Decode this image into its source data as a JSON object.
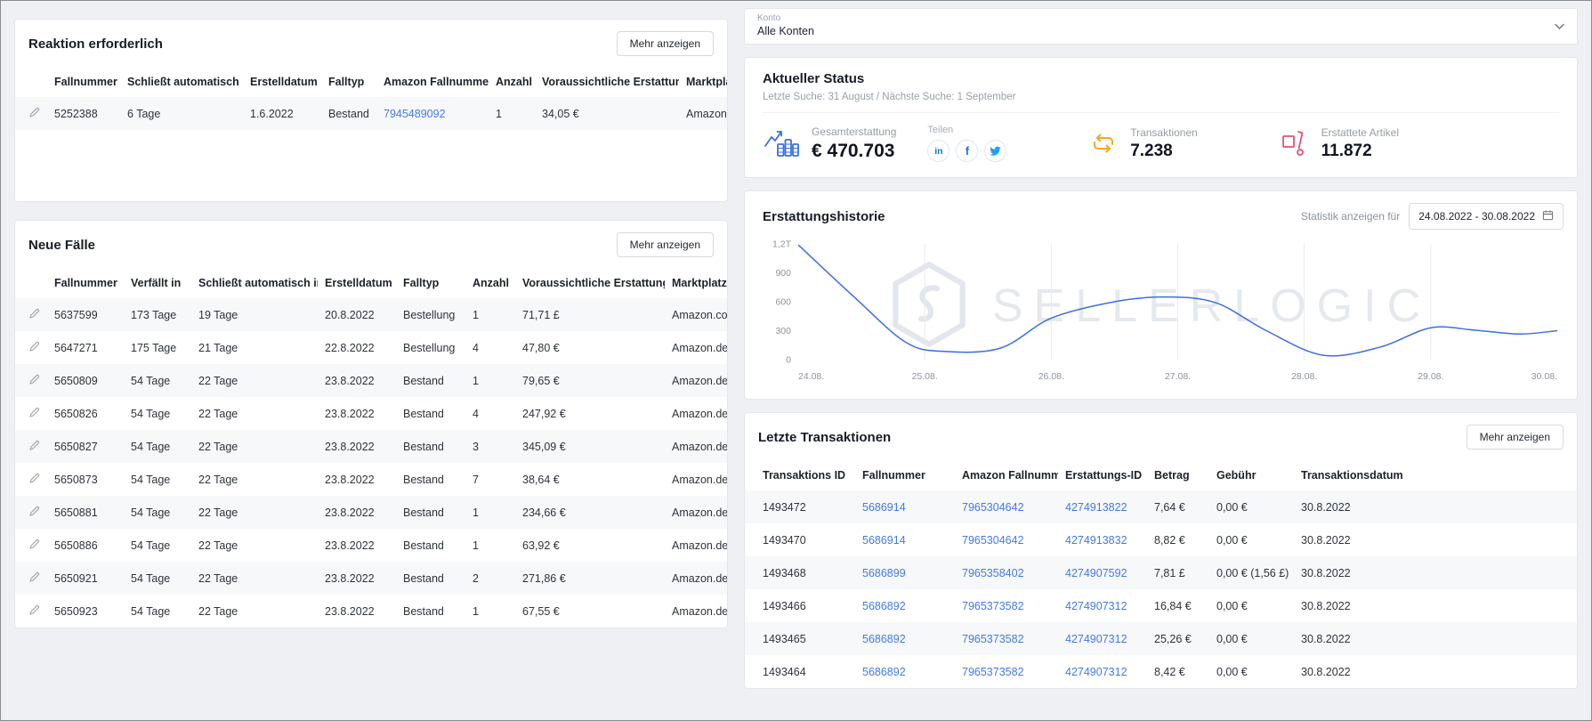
{
  "colors": {
    "accent": "#3d6ee0",
    "link": "#4479e4",
    "orange": "#f5a623",
    "pink": "#e8506e"
  },
  "account_bar": {
    "label": "Konto",
    "value": "Alle Konten"
  },
  "reaction_panel": {
    "title": "Reaktion erforderlich",
    "more_label": "Mehr anzeigen",
    "columns": [
      "Fallnummer",
      "Schließt automatisch in",
      "Erstelldatum",
      "Falltyp",
      "Amazon Fallnummer",
      "Anzahl",
      "Voraussichtliche Erstattung",
      "Marktplatz"
    ],
    "rows": [
      [
        "5252388",
        "6 Tage",
        "1.6.2022",
        "Bestand",
        "7945489092",
        "1",
        "34,05 €",
        "Amazon.de"
      ]
    ]
  },
  "new_cases_panel": {
    "title": "Neue Fälle",
    "more_label": "Mehr anzeigen",
    "columns": [
      "Fallnummer",
      "Verfällt in",
      "Schließt automatisch in",
      "Erstelldatum",
      "Falltyp",
      "Anzahl",
      "Voraussichtliche Erstattung",
      "Marktplatz"
    ],
    "rows": [
      [
        "5637599",
        "173 Tage",
        "19 Tage",
        "20.8.2022",
        "Bestellung",
        "1",
        "71,71 £",
        "Amazon.co.uk"
      ],
      [
        "5647271",
        "175 Tage",
        "21 Tage",
        "22.8.2022",
        "Bestellung",
        "4",
        "47,80 €",
        "Amazon.de"
      ],
      [
        "5650809",
        "54 Tage",
        "22 Tage",
        "23.8.2022",
        "Bestand",
        "1",
        "79,65 €",
        "Amazon.de"
      ],
      [
        "5650826",
        "54 Tage",
        "22 Tage",
        "23.8.2022",
        "Bestand",
        "4",
        "247,92 €",
        "Amazon.de"
      ],
      [
        "5650827",
        "54 Tage",
        "22 Tage",
        "23.8.2022",
        "Bestand",
        "3",
        "345,09 €",
        "Amazon.de"
      ],
      [
        "5650873",
        "54 Tage",
        "22 Tage",
        "23.8.2022",
        "Bestand",
        "7",
        "38,64 €",
        "Amazon.de"
      ],
      [
        "5650881",
        "54 Tage",
        "22 Tage",
        "23.8.2022",
        "Bestand",
        "1",
        "234,66 €",
        "Amazon.de"
      ],
      [
        "5650886",
        "54 Tage",
        "22 Tage",
        "23.8.2022",
        "Bestand",
        "1",
        "63,92 €",
        "Amazon.de"
      ],
      [
        "5650921",
        "54 Tage",
        "22 Tage",
        "23.8.2022",
        "Bestand",
        "2",
        "271,86 €",
        "Amazon.de"
      ],
      [
        "5650923",
        "54 Tage",
        "22 Tage",
        "23.8.2022",
        "Bestand",
        "1",
        "67,55 €",
        "Amazon.de"
      ]
    ]
  },
  "status_panel": {
    "title": "Aktueller Status",
    "subtitle": "Letzte Suche: 31 August / Nächste Suche: 1 September",
    "share_label": "Teilen",
    "share": {
      "linkedin_glyph": "in",
      "facebook_glyph": "f"
    },
    "metrics": {
      "refund": {
        "label": "Gesamterstattung",
        "value": "€ 470.703"
      },
      "transactions": {
        "label": "Transaktionen",
        "value": "7.238"
      },
      "returned": {
        "label": "Erstattete Artikel",
        "value": "11.872"
      }
    }
  },
  "history_panel": {
    "title": "Erstattungshistorie",
    "stats_label": "Statistik anzeigen für",
    "date_range": "24.08.2022 - 30.08.2022",
    "watermark": "SELLERLOGIC"
  },
  "chart_data": {
    "type": "line",
    "title": "Erstattungshistorie",
    "x_labels": [
      "24.08.",
      "25.08.",
      "26.08.",
      "27.08.",
      "28.08.",
      "29.08.",
      "30.08."
    ],
    "values_at_labels": [
      1190,
      110,
      430,
      650,
      120,
      330,
      300
    ],
    "curve_points": [
      [
        0,
        1190
      ],
      [
        0.45,
        640
      ],
      [
        0.85,
        180
      ],
      [
        1.15,
        85
      ],
      [
        1.6,
        120
      ],
      [
        2,
        430
      ],
      [
        2.5,
        600
      ],
      [
        2.9,
        650
      ],
      [
        3.3,
        590
      ],
      [
        3.7,
        300
      ],
      [
        4.15,
        45
      ],
      [
        4.6,
        130
      ],
      [
        5,
        330
      ],
      [
        5.35,
        305
      ],
      [
        5.7,
        265
      ],
      [
        6,
        300
      ]
    ],
    "ylim": [
      0,
      1200
    ],
    "y_ticks": [
      {
        "v": 0,
        "label": "0"
      },
      {
        "v": 300,
        "label": "300"
      },
      {
        "v": 600,
        "label": "600"
      },
      {
        "v": 900,
        "label": "900"
      },
      {
        "v": 1200,
        "label": "1,2T"
      }
    ],
    "line_color": "#3d6ee0",
    "grid_color": "#e9ebef",
    "grid": "vertical-only",
    "legend": "none"
  },
  "transactions_panel": {
    "title": "Letzte Transaktionen",
    "more_label": "Mehr anzeigen",
    "columns": [
      "Transaktions ID",
      "Fallnummer",
      "Amazon Fallnummer",
      "Erstattungs-ID",
      "Betrag",
      "Gebühr",
      "Transaktionsdatum"
    ],
    "rows": [
      [
        "1493472",
        "5686914",
        "7965304642",
        "4274913822",
        "7,64 €",
        "0,00 €",
        "30.8.2022"
      ],
      [
        "1493470",
        "5686914",
        "7965304642",
        "4274913832",
        "8,82 €",
        "0,00 €",
        "30.8.2022"
      ],
      [
        "1493468",
        "5686899",
        "7965358402",
        "4274907592",
        "7,81 £",
        "0,00 € (1,56 £)",
        "30.8.2022"
      ],
      [
        "1493466",
        "5686892",
        "7965373582",
        "4274907312",
        "16,84 €",
        "0,00 €",
        "30.8.2022"
      ],
      [
        "1493465",
        "5686892",
        "7965373582",
        "4274907312",
        "25,26 €",
        "0,00 €",
        "30.8.2022"
      ],
      [
        "1493464",
        "5686892",
        "7965373582",
        "4274907312",
        "8,42 €",
        "0,00 €",
        "30.8.2022"
      ]
    ]
  }
}
